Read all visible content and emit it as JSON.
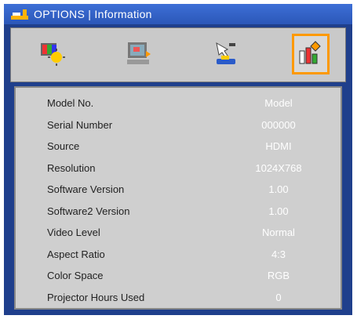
{
  "title": "OPTIONS | Information",
  "tabs": [
    {
      "icon": "picture-settings-icon",
      "active": false
    },
    {
      "icon": "display-settings-icon",
      "active": false
    },
    {
      "icon": "setup-icon",
      "active": false
    },
    {
      "icon": "options-icon",
      "active": true
    }
  ],
  "info": [
    {
      "label": "Model No.",
      "value": "Model"
    },
    {
      "label": "Serial Number",
      "value": "000000"
    },
    {
      "label": "Source",
      "value": "HDMI"
    },
    {
      "label": "Resolution",
      "value": "1024X768"
    },
    {
      "label": "Software Version",
      "value": "1.00"
    },
    {
      "label": "Software2 Version",
      "value": "1.00"
    },
    {
      "label": "Video Level",
      "value": "Normal"
    },
    {
      "label": "Aspect Ratio",
      "value": "4:3"
    },
    {
      "label": "Color Space",
      "value": "RGB"
    },
    {
      "label": "Projector Hours Used",
      "value": "0"
    }
  ],
  "colors": {
    "background": "#1f3f8c",
    "accent": "#ff9900",
    "panel": "#cfcfcf"
  }
}
